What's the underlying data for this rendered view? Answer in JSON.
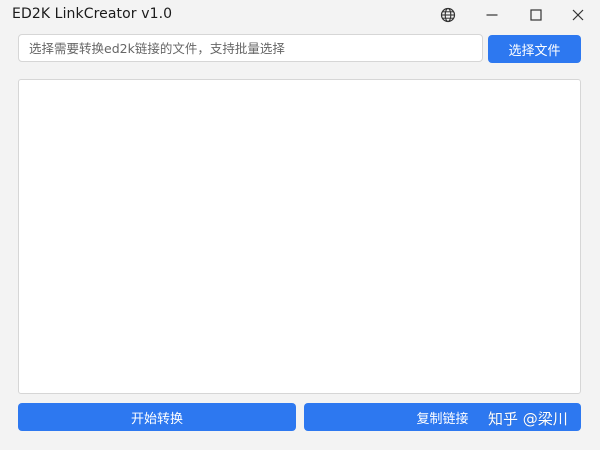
{
  "window": {
    "title": "ED2K LinkCreator v1.0",
    "icons": [
      "globe-icon",
      "minimize-icon",
      "maximize-icon",
      "close-icon"
    ]
  },
  "file_input": {
    "placeholder": "选择需要转换ed2k链接的文件，支持批量选择",
    "value": ""
  },
  "buttons": {
    "select_file": "选择文件",
    "start_convert": "开始转换",
    "copy_links": "复制链接"
  },
  "output": {
    "value": ""
  },
  "watermark": {
    "text": "知乎 @梁川"
  },
  "colors": {
    "accent": "#2d78f0",
    "background": "#f3f3f3",
    "field_background": "#ffffff",
    "border": "#d6d6d6"
  }
}
